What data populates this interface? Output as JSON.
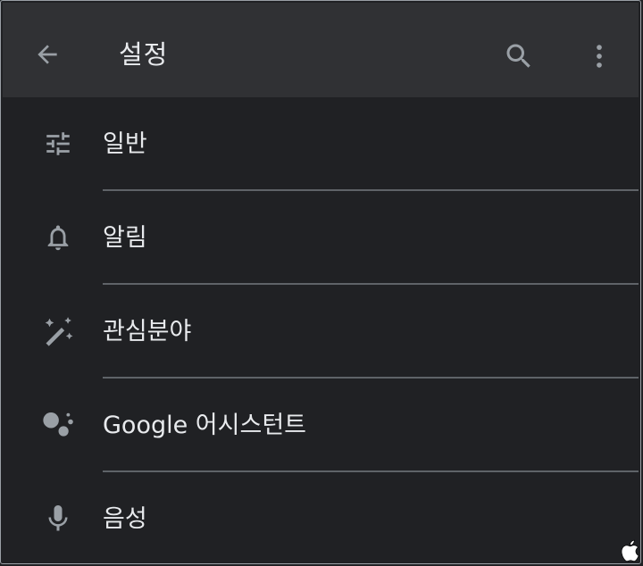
{
  "appbar": {
    "title": "설정",
    "back_icon": "arrow-back-icon",
    "search_icon": "search-icon",
    "more_icon": "more-vert-icon"
  },
  "settings": {
    "items": [
      {
        "label": "일반",
        "icon": "tune-icon"
      },
      {
        "label": "알림",
        "icon": "bell-icon"
      },
      {
        "label": "관심분야",
        "icon": "magic-wand-icon"
      },
      {
        "label": "Google 어시스턴트",
        "icon": "assistant-icon"
      },
      {
        "label": "음성",
        "icon": "mic-icon"
      }
    ]
  },
  "colors": {
    "background": "#202124",
    "appbar": "#303134",
    "text": "#e8eaed",
    "icon": "#9aa0a6",
    "divider": "#5f6368"
  }
}
